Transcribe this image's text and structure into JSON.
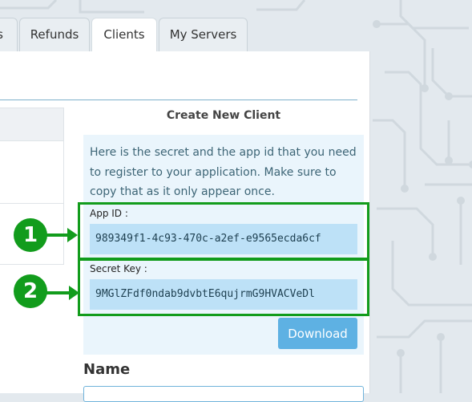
{
  "tabs": [
    {
      "label": "s"
    },
    {
      "label": "Refunds"
    },
    {
      "label": "Clients"
    },
    {
      "label": "My Servers"
    }
  ],
  "active_tab": "Clients",
  "create_client": {
    "title": "Create New Client",
    "message": "Here is the secret and the app id that you need to register to your application. Make sure to copy that as it only appear once.",
    "app_id_label": "App ID :",
    "app_id_value": "989349f1-4c93-470c-a2ef-e9565ecda6cf",
    "secret_key_label": "Secret Key :",
    "secret_key_value": "9MGlZFdf0ndab9dvbtE6qujrmG9HVACVeDl",
    "download_label": "Download"
  },
  "callouts": [
    "1",
    "2"
  ],
  "form": {
    "name_label": "Name",
    "name_value": ""
  },
  "colors": {
    "highlight_green": "#129c1c",
    "button_blue": "#5eb1e3",
    "info_bg": "#eaf5fc",
    "field_bg": "#bde1f7"
  }
}
